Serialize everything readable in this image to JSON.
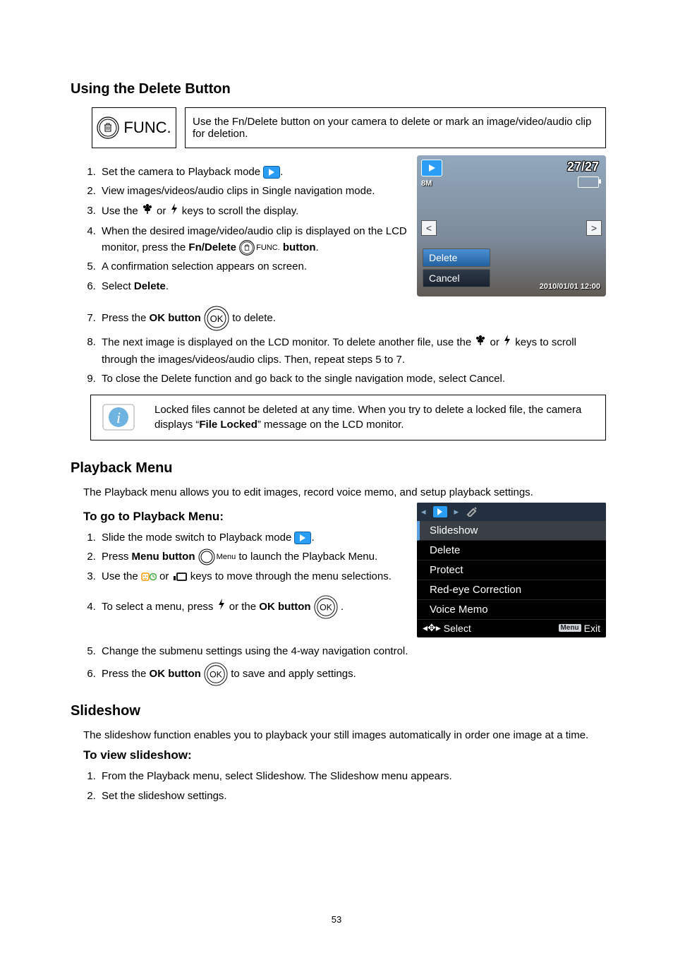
{
  "pageNumber": "53",
  "section1": {
    "heading": "Using the Delete Button",
    "funcLabel": "FUNC.",
    "tip": "Use the Fn/Delete button on your camera to delete or mark an image/video/audio clip for deletion.",
    "steps": {
      "s1a": "Set the camera to Playback mode ",
      "s1b": ".",
      "s2": "View images/videos/audio clips in Single navigation mode.",
      "s3a": "Use the ",
      "s3b": " or ",
      "s3c": " keys to scroll the display.",
      "s4a": "When the desired image/video/audio clip is displayed on the LCD monitor, press the ",
      "s4b": "Fn/Delete",
      "s4c": " ",
      "s4d": " button",
      "s4e": ".",
      "funcSmall": "FUNC.",
      "s5": "A confirmation selection appears on screen.",
      "s6a": "Select ",
      "s6b": "Delete",
      "s6c": ".",
      "s7a": "Press the ",
      "s7b": "OK button",
      "s7c": " to delete.",
      "s8a": "The next image is displayed on the LCD monitor. To delete another file, use the ",
      "s8b": " or ",
      "s8c": " keys to scroll through the images/videos/audio clips. Then, repeat steps 5 to 7.",
      "s9": "To close the Delete function and go back to the single navigation mode, select Cancel."
    },
    "lcd": {
      "count": "27/27",
      "res": "8M",
      "delete": "Delete",
      "cancel": "Cancel",
      "timestamp": "2010/01/01  12:00"
    },
    "note": "Locked files cannot be deleted at any time. When you try to delete a locked file, the camera displays “",
    "noteBold": "File Locked",
    "noteTail": "” message on the LCD monitor."
  },
  "section2": {
    "heading": "Playback Menu",
    "intro": "The Playback menu allows you to edit images, record voice memo, and setup playback settings.",
    "sub1": "To go to Playback Menu:",
    "steps": {
      "s1a": "Slide the mode switch to Playback mode ",
      "s1b": ".",
      "s2a": "Press ",
      "s2b": "Menu button",
      "s2c": " ",
      "s2menu": "Menu",
      "s2d": " to launch the Playback Menu.",
      "s3a": "Use the ",
      "s3b": " or ",
      "s3c": " keys to move through the menu selections.",
      "s4a": "To select a menu, press ",
      "s4b": " or the ",
      "s4c": "OK button",
      "s4d": " .",
      "s5": "Change the submenu settings using the 4-way navigation control.",
      "s6a": "Press the ",
      "s6b": "OK button",
      "s6c": " to save and apply settings."
    },
    "menu": {
      "items": [
        "Slideshow",
        "Delete",
        "Protect",
        "Red-eye Correction",
        "Voice Memo"
      ],
      "selectLabel": "Select",
      "exitLabel": "Exit",
      "menuTag": "Menu"
    }
  },
  "section3": {
    "heading": "Slideshow",
    "intro": "The slideshow function enables you to playback your still images automatically in order one image at a time.",
    "sub1": "To view slideshow:",
    "steps": {
      "s1": "From the Playback menu, select Slideshow. The Slideshow menu appears.",
      "s2": "Set the slideshow settings."
    }
  }
}
